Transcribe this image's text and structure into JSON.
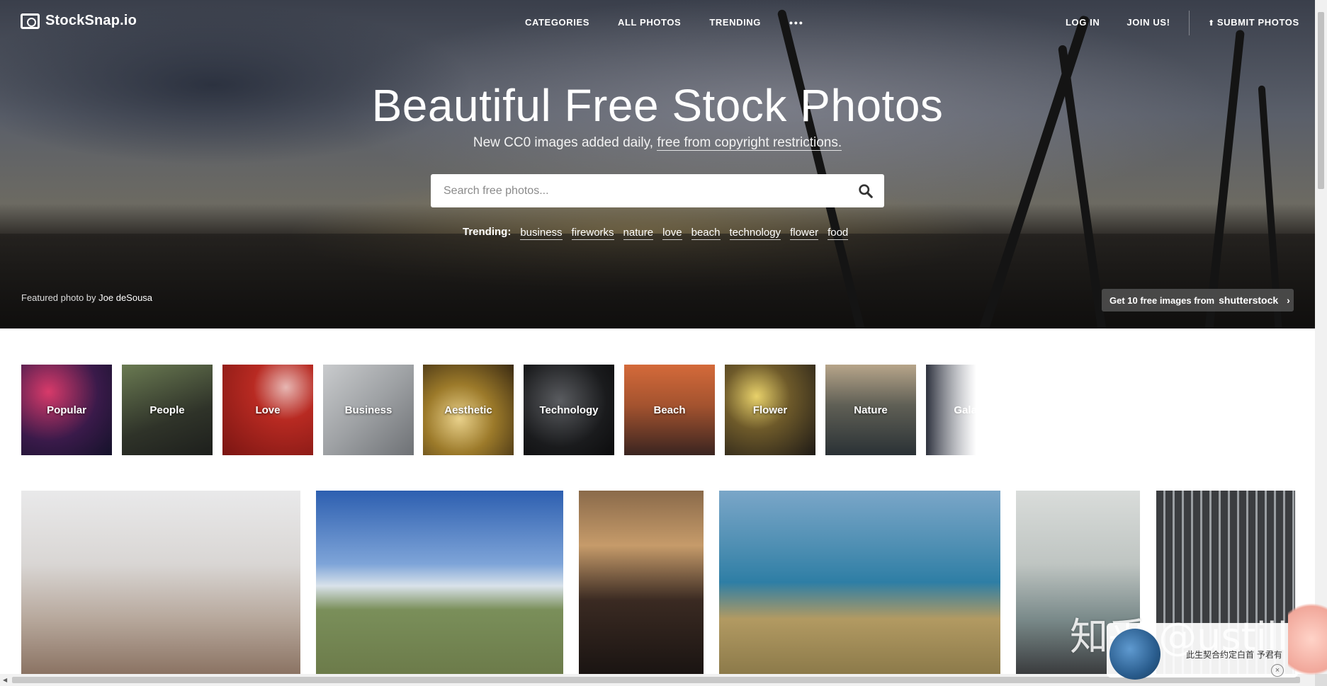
{
  "header": {
    "logo_text": "StockSnap.io",
    "nav_center": [
      "CATEGORIES",
      "ALL PHOTOS",
      "TRENDING"
    ],
    "more_label": "•••",
    "login": "LOG IN",
    "join": "JOIN US!",
    "submit": "SUBMIT PHOTOS"
  },
  "hero": {
    "title": "Beautiful Free Stock Photos",
    "subtitle_prefix": "New CC0 images added daily, ",
    "subtitle_link": "free from copyright restrictions.",
    "search_placeholder": "Search free photos...",
    "trending_label": "Trending:",
    "trending_tags": [
      "business",
      "fireworks",
      "nature",
      "love",
      "beach",
      "technology",
      "flower",
      "food"
    ],
    "featured_prefix": "Featured photo by ",
    "featured_author": "Joe deSousa",
    "promo_text": "Get 10 free images from",
    "promo_brand": "shutterstock"
  },
  "categories": [
    {
      "label": "Popular",
      "bg": "radial-gradient(circle at 30% 30%, #d83a6a, #3a1a4a 55%, #14122a)"
    },
    {
      "label": "People",
      "bg": "linear-gradient(160deg, #6a7a52, #2f3329 60%, #1d1f1c)"
    },
    {
      "label": "Love",
      "bg": "radial-gradient(circle at 70% 25%, #e7b7b3, #b82a22 35%, #7a1512)"
    },
    {
      "label": "Business",
      "bg": "linear-gradient(135deg, #c9cbcd, #9ea1a4 50%, #6e7175)"
    },
    {
      "label": "Aesthetic",
      "bg": "radial-gradient(circle at 40% 60%, #e8d08a, #9c7a2a 45%, #3a2a12)"
    },
    {
      "label": "Technology",
      "bg": "radial-gradient(circle at 40% 40%, #5a5c60, #1a1b1d 60%, #0c0c0d)"
    },
    {
      "label": "Beach",
      "bg": "linear-gradient(180deg, #d46a3a, #a4532f 45%, #3a2420)"
    },
    {
      "label": "Flower",
      "bg": "radial-gradient(circle at 35% 35%, #e8d16a, #6e5a2a 40%, #1e1a16)"
    },
    {
      "label": "Nature",
      "bg": "linear-gradient(180deg, #b7a58a, #5f5f55 45%, #2a3135)"
    },
    {
      "label": "Galaxy",
      "bg": "linear-gradient(90deg, #2a2e3a, #7a7e8a 60%, #e6e6ea)"
    }
  ],
  "photos": [
    {
      "name": "photo-family",
      "bg": "linear-gradient(180deg, #e9e9ea 0%, #d9d6d4 40%, #b7a89c 70%, #8b7363 100%)"
    },
    {
      "name": "photo-mountains",
      "bg": "linear-gradient(180deg, #2d5fb0 0%, #7ea4d8 40%, #d9e2ea 52%, #7a8f5a 65%, #6c7b4a 100%)"
    },
    {
      "name": "photo-woman-jacket",
      "bg": "linear-gradient(180deg, #8a6a4a 0%, #c69b6a 30%, #3a2a22 60%, #1a1412 100%)"
    },
    {
      "name": "photo-sheep-coast",
      "bg": "linear-gradient(180deg, #7aa6c8 0%, #4f8fb3 30%, #2e7ea5 50%, #b29a62 70%, #8c7a4a 100%)"
    },
    {
      "name": "photo-doctor",
      "bg": "linear-gradient(180deg, #d9dcda 0%, #bfc5c2 40%, #7a8a8a 70%, #3a3c3e 100%)"
    },
    {
      "name": "photo-building",
      "bg": "repeating-linear-gradient(90deg, #3b3d40 0px, #3b3d40 10px, #9a9ea2 10px, #9a9ea2 13px)"
    }
  ],
  "watermark": {
    "text": "知乎 @ustill",
    "popup_text": "此生契合约定白首 予君有",
    "close": "×"
  }
}
